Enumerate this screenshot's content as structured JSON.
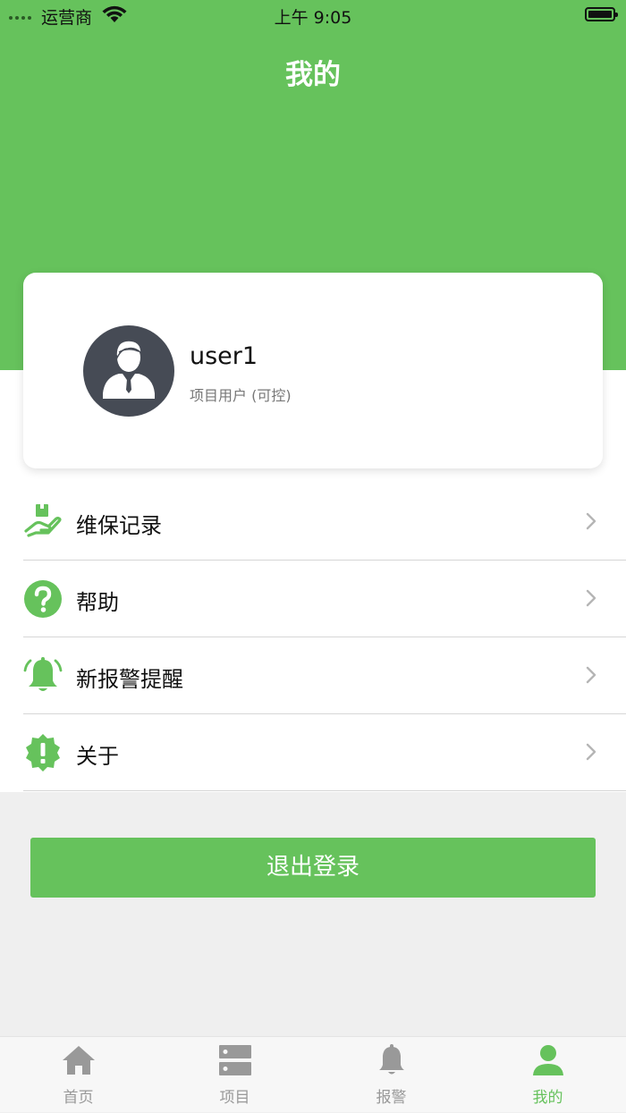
{
  "status_bar": {
    "carrier": "运营商",
    "time": "上午 9:05"
  },
  "header": {
    "title": "我的"
  },
  "profile": {
    "username": "user1",
    "role": "项目用户 (可控)"
  },
  "menu": [
    {
      "label": "维保记录",
      "icon": "maintenance-hand-icon"
    },
    {
      "label": "帮助",
      "icon": "help-question-icon"
    },
    {
      "label": "新报警提醒",
      "icon": "alarm-bell-icon"
    },
    {
      "label": "关于",
      "icon": "about-exclamation-icon"
    }
  ],
  "logout": {
    "label": "退出登录"
  },
  "tabs": [
    {
      "label": "首页",
      "icon": "home-icon"
    },
    {
      "label": "项目",
      "icon": "project-list-icon"
    },
    {
      "label": "报警",
      "icon": "bell-icon"
    },
    {
      "label": "我的",
      "icon": "person-icon",
      "active": true
    }
  ],
  "colors": {
    "accent": "#66c25c",
    "avatar_bg": "#464b55",
    "inactive_tab": "#999999",
    "page_bg": "#efefef"
  }
}
